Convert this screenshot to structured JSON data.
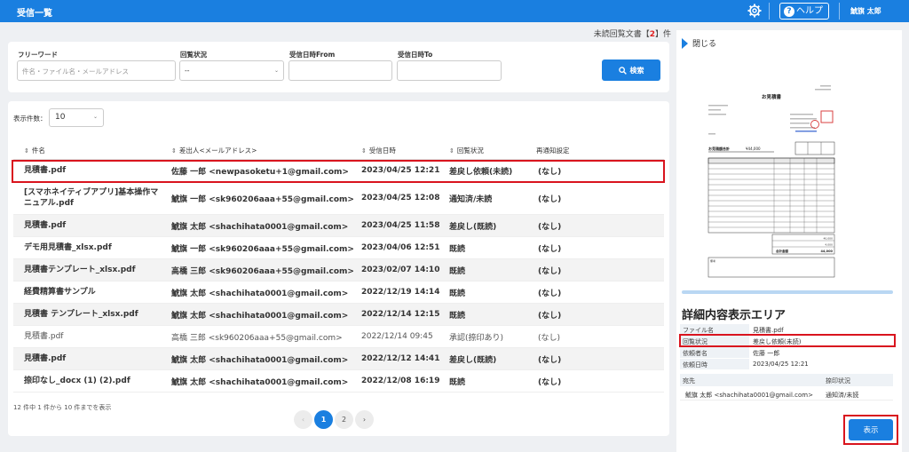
{
  "header": {
    "title": "受信一覧",
    "help_label": "ヘルプ",
    "user_name": "鯱旗 太郎"
  },
  "unread": {
    "prefix": "未読回覧文書【",
    "count": "2",
    "suffix": "】件"
  },
  "search": {
    "freeword_label": "フリーワード",
    "freeword_placeholder": "件名・ファイル名・メールアドレス",
    "status_label": "回覧状況",
    "status_value": "--",
    "from_label": "受信日時From",
    "to_label": "受信日時To",
    "button_label": "検索"
  },
  "list": {
    "perpage_label": "表示件数：",
    "perpage_value": "10",
    "columns": [
      "件名",
      "差出人<メールアドレス>",
      "受信日時",
      "回覧状況",
      "再通知設定"
    ],
    "rows": [
      {
        "subject": "見積書.pdf",
        "sender": "佐藤 一郎 <newpasoketu+1@gmail.com>",
        "date": "2023/04/25 12:21",
        "status": "差戻し依頼(未読)",
        "notify": "(なし)"
      },
      {
        "subject": "[スマホネイティブアプリ]基本操作マニュアル.pdf",
        "sender": "鯱旗 一郎 <sk960206aaa+55@gmail.com>",
        "date": "2023/04/25 12:08",
        "status": "通知済/未読",
        "notify": "(なし)"
      },
      {
        "subject": "見積書.pdf",
        "sender": "鯱旗 太郎 <shachihata0001@gmail.com>",
        "date": "2023/04/25 11:58",
        "status": "差戻し(既読)",
        "notify": "(なし)"
      },
      {
        "subject": "デモ用見積書_xlsx.pdf",
        "sender": "鯱旗 一郎 <sk960206aaa+55@gmail.com>",
        "date": "2023/04/06 12:51",
        "status": "既読",
        "notify": "(なし)"
      },
      {
        "subject": "見積書テンプレート_xlsx.pdf",
        "sender": "高橋 三郎 <sk960206aaa+55@gmail.com>",
        "date": "2023/02/07 14:10",
        "status": "既読",
        "notify": "(なし)"
      },
      {
        "subject": "経費精算書サンプル",
        "sender": "鯱旗 太郎 <shachihata0001@gmail.com>",
        "date": "2022/12/19 14:14",
        "status": "既読",
        "notify": "(なし)"
      },
      {
        "subject": "見積書 テンプレート_xlsx.pdf",
        "sender": "鯱旗 太郎 <shachihata0001@gmail.com>",
        "date": "2022/12/14 12:15",
        "status": "既読",
        "notify": "(なし)"
      },
      {
        "subject": "見積書.pdf",
        "sender": "高橋 三郎 <sk960206aaa+55@gmail.com>",
        "date": "2022/12/14 09:45",
        "status": "承認(捺印あり)",
        "notify": "(なし)"
      },
      {
        "subject": "見積書.pdf",
        "sender": "鯱旗 太郎 <shachihata0001@gmail.com>",
        "date": "2022/12/12 14:41",
        "status": "差戻し(既読)",
        "notify": "(なし)"
      },
      {
        "subject": "捺印なし_docx (1) (2).pdf",
        "sender": "鯱旗 太郎 <shachihata0001@gmail.com>",
        "date": "2022/12/08 16:19",
        "status": "既読",
        "notify": "(なし)"
      }
    ],
    "range_text": "12 件中 1 件から 10 件までを表示",
    "pager": {
      "prev": "‹",
      "pages": [
        "1",
        "2"
      ],
      "next": "›"
    }
  },
  "panel": {
    "close_label": "閉じる",
    "doc": {
      "title": "お見積書",
      "amount_label": "お見積額合計",
      "amount_value": "¥44,000",
      "sub1_value": "40,000",
      "sub2_value": "4,000",
      "total_label": "合計金額",
      "total_value": "44,000",
      "note_label": "備考"
    },
    "detail_title": "詳細内容表示エリア",
    "details": [
      {
        "k": "ファイル名",
        "v": "見積書.pdf"
      },
      {
        "k": "回覧状況",
        "v": "差戻し依頼(未読)"
      },
      {
        "k": "依頼者名",
        "v": "佐藤 一郎"
      },
      {
        "k": "依頼日時",
        "v": "2023/04/25 12:21"
      }
    ],
    "recipient_header": {
      "to": "宛先",
      "stamp": "捺印状況"
    },
    "recipient": {
      "to": "鯱旗 太郎 <shachihata0001@gmail.com>",
      "stamp": "通知済/未読"
    },
    "show_button": "表示"
  }
}
